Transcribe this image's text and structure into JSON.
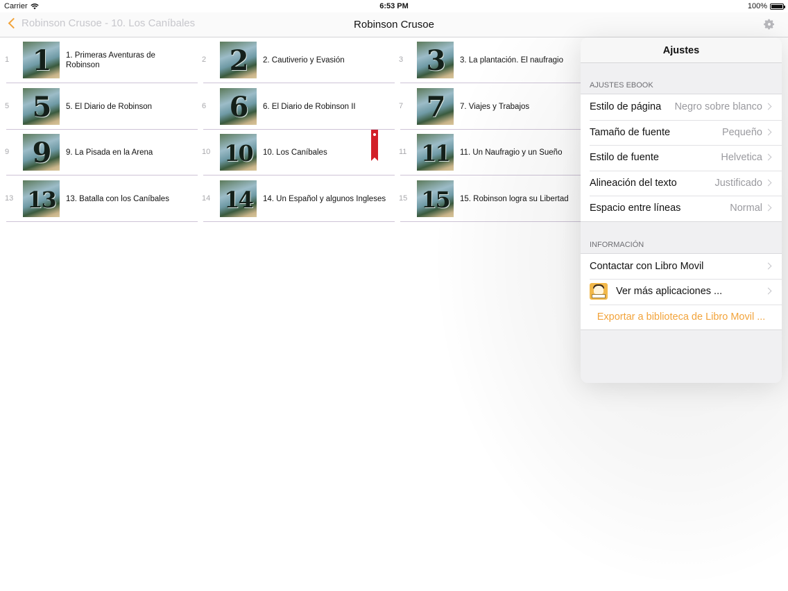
{
  "status_bar": {
    "carrier": "Carrier",
    "time": "6:53 PM",
    "battery": "100%",
    "battery_level": 1.0
  },
  "nav": {
    "back_label": "Robinson Crusoe - 10. Los Caníbales",
    "title": "Robinson Crusoe"
  },
  "chapters": [
    {
      "index": "1",
      "thumb": "1",
      "title": "1. Primeras Aventuras de Robinson"
    },
    {
      "index": "2",
      "thumb": "2",
      "title": "2. Cautiverio y Evasión"
    },
    {
      "index": "3",
      "thumb": "3",
      "title": "3. La plantación. El naufragio"
    },
    {
      "index": "5",
      "thumb": "5",
      "title": "5. El Diario de Robinson"
    },
    {
      "index": "6",
      "thumb": "6",
      "title": "6. El Diario de Robinson II"
    },
    {
      "index": "7",
      "thumb": "7",
      "title": "7. Viajes y Trabajos"
    },
    {
      "index": "9",
      "thumb": "9",
      "title": "9. La Pisada en la Arena"
    },
    {
      "index": "10",
      "thumb": "10",
      "title": "10. Los Caníbales",
      "bookmarked": true
    },
    {
      "index": "11",
      "thumb": "11",
      "title": "11. Un Naufragio y un Sueño"
    },
    {
      "index": "13",
      "thumb": "13",
      "title": "13. Batalla con los Caníbales"
    },
    {
      "index": "14",
      "thumb": "14",
      "title": "14. Un Español y algunos Ingleses"
    },
    {
      "index": "15",
      "thumb": "15",
      "title": "15. Robinson logra su Libertad"
    }
  ],
  "settings": {
    "title": "Ajustes",
    "ebook_section": "AJUSTES EBOOK",
    "ebook_rows": [
      {
        "label": "Estilo de página",
        "value": "Negro sobre blanco"
      },
      {
        "label": "Tamaño de fuente",
        "value": "Pequeño"
      },
      {
        "label": "Estilo de fuente",
        "value": "Helvetica"
      },
      {
        "label": "Alineación del texto",
        "value": "Justificado"
      },
      {
        "label": "Espacio entre líneas",
        "value": "Normal"
      }
    ],
    "info_section": "INFORMACIÓN",
    "contact_label": "Contactar con Libro Movil",
    "more_apps_label": "Ver más aplicaciones ...",
    "export_label": "Exportar a biblioteca de Libro Movil ..."
  },
  "colors": {
    "accent": "#f2a33a",
    "bookmark": "#d22028",
    "separator": "#cdc3d6"
  }
}
